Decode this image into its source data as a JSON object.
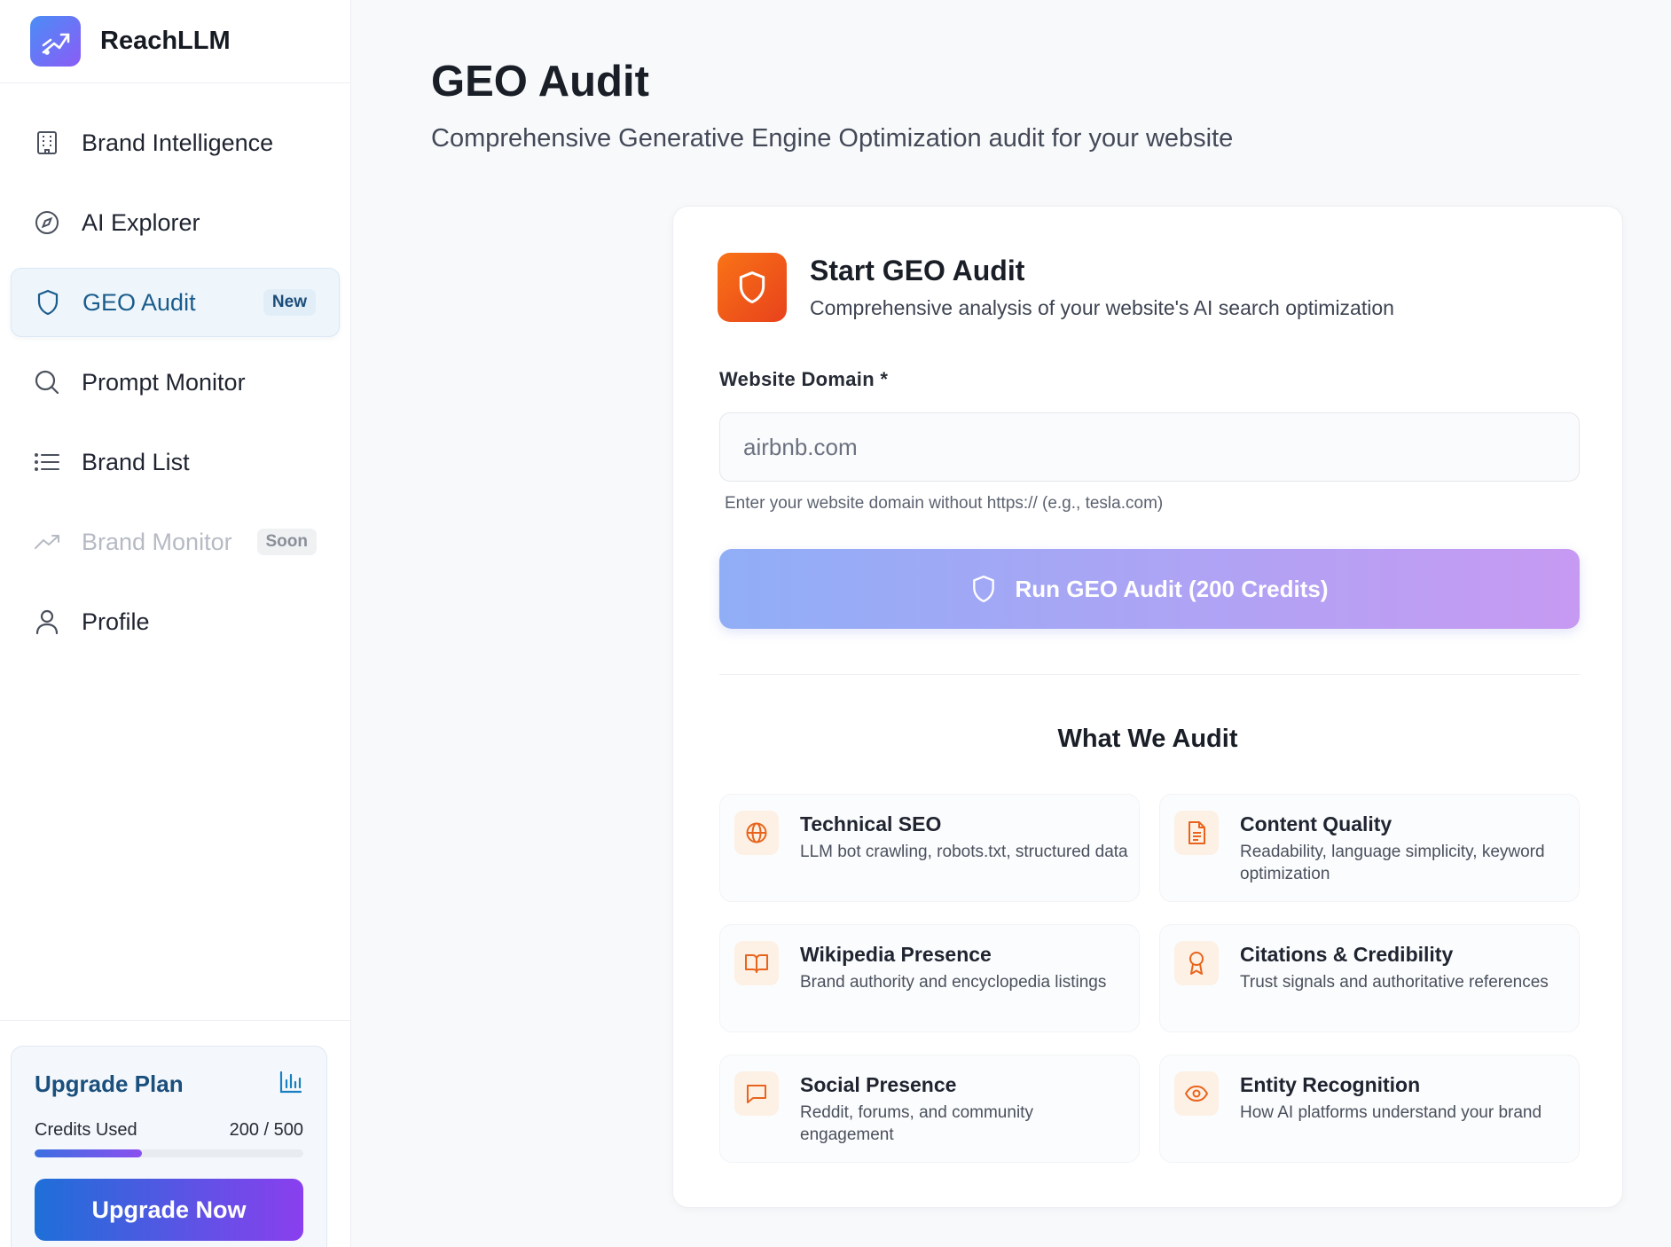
{
  "app": {
    "name": "ReachLLM"
  },
  "sidebar": {
    "items": [
      {
        "label": "Brand Intelligence",
        "icon": "building-icon"
      },
      {
        "label": "AI Explorer",
        "icon": "compass-icon"
      },
      {
        "label": "GEO Audit",
        "icon": "shield-icon",
        "badge": "New",
        "active": true
      },
      {
        "label": "Prompt Monitor",
        "icon": "search-icon"
      },
      {
        "label": "Brand List",
        "icon": "list-icon"
      },
      {
        "label": "Brand Monitor",
        "icon": "trend-icon",
        "badge": "Soon",
        "disabled": true
      },
      {
        "label": "Profile",
        "icon": "user-icon"
      }
    ],
    "upgrade": {
      "title": "Upgrade Plan",
      "credits_label": "Credits Used",
      "credits_value": "200 / 500",
      "credits_fraction": 0.4,
      "button_label": "Upgrade Now"
    }
  },
  "main": {
    "title": "GEO Audit",
    "subtitle": "Comprehensive Generative Engine Optimization audit for your website",
    "card": {
      "title": "Start GEO Audit",
      "subtitle": "Comprehensive analysis of your website's AI search optimization",
      "field_label": "Website Domain *",
      "input_placeholder": "airbnb.com",
      "hint": "Enter your website domain without https:// (e.g., tesla.com)",
      "run_button": "Run GEO Audit (200 Credits)",
      "section_title": "What We Audit",
      "audits": [
        {
          "title": "Technical SEO",
          "desc": "LLM bot crawling, robots.txt, structured data",
          "icon": "globe-icon"
        },
        {
          "title": "Content Quality",
          "desc": "Readability, language simplicity, keyword optimization",
          "icon": "document-icon"
        },
        {
          "title": "Wikipedia Presence",
          "desc": "Brand authority and encyclopedia listings",
          "icon": "book-icon"
        },
        {
          "title": "Citations & Credibility",
          "desc": "Trust signals and authoritative references",
          "icon": "award-icon"
        },
        {
          "title": "Social Presence",
          "desc": "Reddit, forums, and community engagement",
          "icon": "chat-icon"
        },
        {
          "title": "Entity Recognition",
          "desc": "How AI platforms understand your brand",
          "icon": "eye-icon"
        }
      ]
    }
  },
  "colors": {
    "accent": "#1a5c8c",
    "icon_orange": "#e8641c",
    "run_gradient_start": "#90aef6",
    "run_gradient_end": "#c79af2"
  }
}
